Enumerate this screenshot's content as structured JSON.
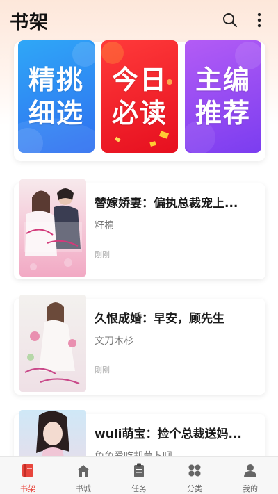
{
  "header": {
    "title": "书架",
    "search_icon": "search-icon",
    "more_icon": "more-vertical-icon"
  },
  "features": [
    {
      "line1": "精挑",
      "line2": "细选",
      "color": "#2f8af5"
    },
    {
      "line1": "今日",
      "line2": "必读",
      "color": "#f22a2e"
    },
    {
      "line1": "主编",
      "line2": "推荐",
      "color": "#9a4cf2"
    }
  ],
  "books": [
    {
      "title": "替嫁娇妻：偏执总裁宠上...",
      "author": "籽棉",
      "time": "刚刚"
    },
    {
      "title": "久恨成婚：早安，顾先生",
      "author": "文刀木杉",
      "time": "刚刚"
    },
    {
      "title": "wuli萌宝：捡个总裁送妈...",
      "author": "兔兔爱吃胡萝卜呗",
      "time": ""
    }
  ],
  "tabs": [
    {
      "label": "书架",
      "icon": "book-icon",
      "active": true
    },
    {
      "label": "书城",
      "icon": "home-icon",
      "active": false
    },
    {
      "label": "任务",
      "icon": "clipboard-icon",
      "active": false
    },
    {
      "label": "分类",
      "icon": "grid-icon",
      "active": false
    },
    {
      "label": "我的",
      "icon": "person-icon",
      "active": false
    }
  ],
  "colors": {
    "accent": "#e8453c",
    "tab_inactive": "#666666"
  }
}
